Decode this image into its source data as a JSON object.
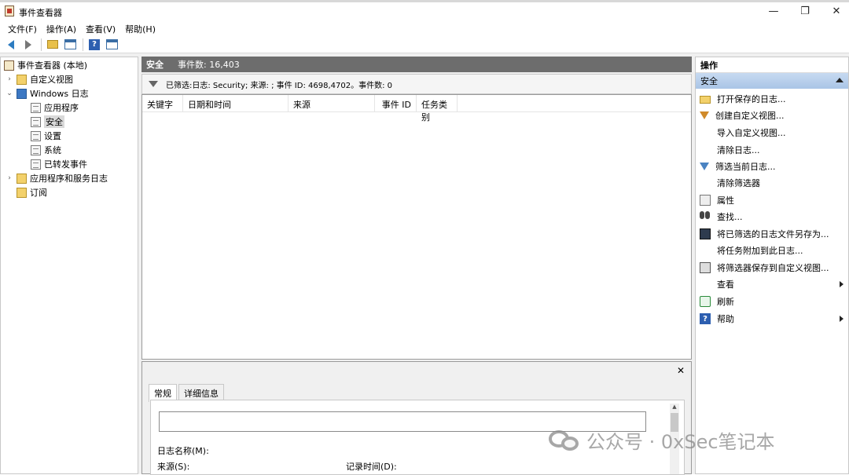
{
  "window": {
    "title": "事件查看器"
  },
  "menu": [
    "文件(F)",
    "操作(A)",
    "查看(V)",
    "帮助(H)"
  ],
  "tree": {
    "root": "事件查看器 (本地)",
    "custom_views": "自定义视图",
    "windows_logs": "Windows 日志",
    "app": "应用程序",
    "security": "安全",
    "setup": "设置",
    "system": "系统",
    "forwarded": "已转发事件",
    "app_services": "应用程序和服务日志",
    "subscriptions": "订阅"
  },
  "center": {
    "log_name": "安全",
    "event_count": "事件数: 16,403",
    "filter_text": "已筛选:日志: Security; 来源: ; 事件 ID: 4698,4702。事件数: 0",
    "columns": [
      "关键字",
      "日期和时间",
      "来源",
      "事件 ID",
      "任务类别"
    ]
  },
  "detail": {
    "close": "✕",
    "tabs": [
      "常规",
      "详细信息"
    ],
    "log_name_label": "日志名称(M):",
    "source_label": "来源(S):",
    "logged_label": "记录时间(D):"
  },
  "actions": {
    "header": "操作",
    "section": "安全",
    "items": [
      "打开保存的日志...",
      "创建自定义视图...",
      "导入自定义视图...",
      "清除日志...",
      "筛选当前日志...",
      "清除筛选器",
      "属性",
      "查找...",
      "将已筛选的日志文件另存为...",
      "将任务附加到此日志...",
      "将筛选器保存到自定义视图...",
      "查看",
      "刷新",
      "帮助"
    ]
  },
  "watermark": "公众号 · 0xSec笔记本"
}
